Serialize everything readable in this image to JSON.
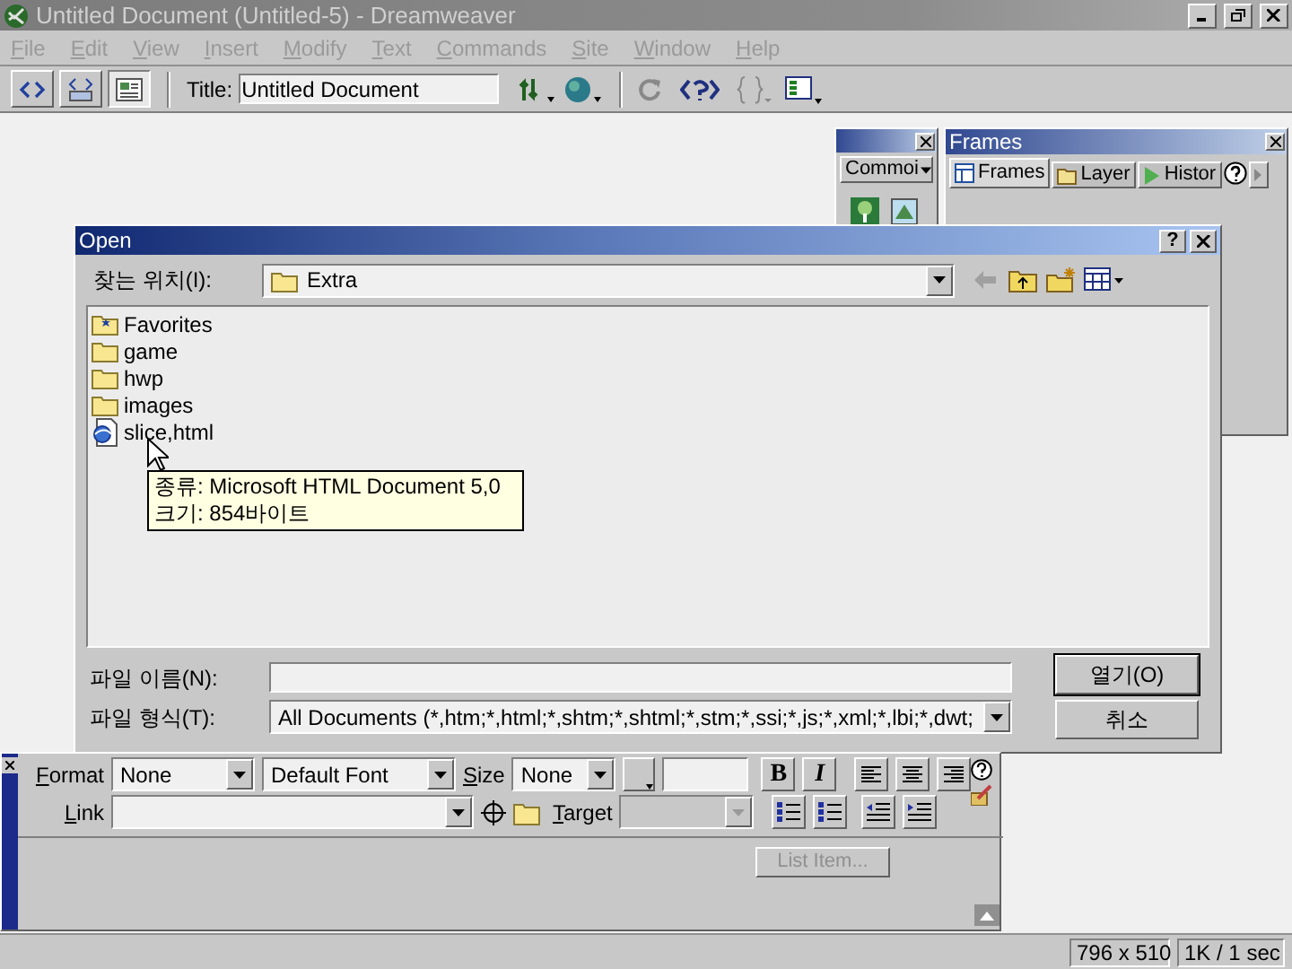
{
  "window": {
    "title": "Untitled Document (Untitled-5) - Dreamweaver",
    "active": false
  },
  "menu": {
    "disabled": true,
    "items": [
      "File",
      "Edit",
      "View",
      "Insert",
      "Modify",
      "Text",
      "Commands",
      "Site",
      "Window",
      "Help"
    ]
  },
  "toolbar": {
    "views": [
      {
        "selected": false
      },
      {
        "selected": false
      },
      {
        "selected": true
      }
    ],
    "title_label": "Title:",
    "title_value": "Untitled Document"
  },
  "objects_panel": {
    "category": "Commoi"
  },
  "frames_panel": {
    "title": "Frames",
    "tabs": [
      {
        "label": "Frames",
        "selected": true
      },
      {
        "label": "Layer",
        "selected": false
      },
      {
        "label": "Histor",
        "selected": false
      }
    ]
  },
  "dialog": {
    "title": "Open",
    "help_button": "?",
    "look_in_label": "찾는 위치(I):",
    "look_in": "Extra",
    "files": [
      {
        "name": "Favorites",
        "kind": "favorites"
      },
      {
        "name": "game",
        "kind": "folder"
      },
      {
        "name": "hwp",
        "kind": "folder"
      },
      {
        "name": "images",
        "kind": "folder"
      },
      {
        "name": "slice,html",
        "kind": "html"
      }
    ],
    "tooltip": [
      "종류: Microsoft HTML Document 5,0",
      "크기: 854바이트"
    ],
    "file_name_label": "파일 이름(N):",
    "file_type_label": "파일 형식(T):",
    "file_type": "All Documents (*,htm;*,html;*,shtm;*,shtml;*,stm;*,ssi;*,js;*,xml;*,lbi;*,dwt;",
    "buttons": [
      {
        "label": "열기(O)",
        "default": true
      },
      {
        "label": "취소",
        "default": false
      }
    ]
  },
  "properties": {
    "format_label": "Format",
    "format": "None",
    "font": "Default Font",
    "size_label": "Size",
    "size": "None",
    "bold": "B",
    "italic": "I",
    "link_label": "Link",
    "target_label": "Target",
    "target_disabled": true,
    "list_item": "List Item...",
    "list_item_disabled": true
  },
  "status_bar": [
    "796 x 510",
    "1K / 1 sec"
  ]
}
